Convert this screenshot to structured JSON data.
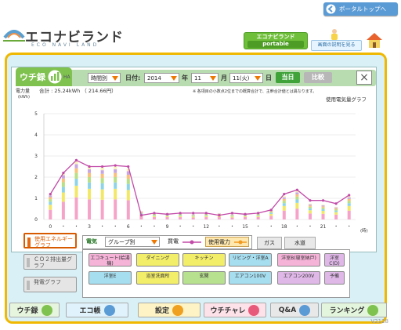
{
  "header": {
    "portal_button": "ポータルトップへ",
    "logo_jp": "エコナビランド",
    "logo_en": "ECO NAVI LAND",
    "portable_line1": "エコナビランド",
    "portable_line2": "portable",
    "explain_button": "画面の説明を見る"
  },
  "window": {
    "tab_title": "ウチ録",
    "tab_suffix": "HA",
    "mode_select": "時間別",
    "date_label": "日付:",
    "year_value": "2014",
    "year_unit": "年",
    "month_value": "11",
    "month_unit": "月",
    "day_value": "11(火)",
    "day_unit": "日",
    "today_button": "当日",
    "compare_button": "比較",
    "close_button": "×"
  },
  "chart_header": {
    "y_unit_line1": "電力量",
    "y_unit_line2": "(kWh)",
    "total": "合計 : 25.24kWh （ 214.66円）",
    "note": "※ 各項目の小数点2位までの概算合計で、主幹合計値とは異なります。",
    "chart_title": "使用電気量グラフ",
    "x_unit": "(時)"
  },
  "chart_data": {
    "type": "bar",
    "categories": [
      "0",
      "1",
      "2",
      "3",
      "4",
      "5",
      "6",
      "7",
      "8",
      "9",
      "10",
      "11",
      "12",
      "13",
      "14",
      "15",
      "16",
      "17",
      "18",
      "19",
      "20",
      "21",
      "22",
      "23"
    ],
    "x_tick_labels": [
      "0",
      "・",
      "・",
      "3",
      "・",
      "・",
      "6",
      "・",
      "・",
      "9",
      "・",
      "・",
      "12",
      "・",
      "・",
      "15",
      "・",
      "・",
      "18",
      "・",
      "・",
      "21",
      "・",
      "・"
    ],
    "values": [
      1.2,
      2.2,
      2.75,
      2.5,
      2.45,
      2.5,
      2.4,
      0.4,
      0.3,
      0.3,
      0.3,
      0.25,
      0.3,
      0.3,
      0.25,
      0.3,
      0.3,
      0.45,
      1.1,
      1.35,
      0.75,
      0.7,
      0.6,
      1.1
    ],
    "line_values": [
      1.2,
      2.2,
      2.8,
      2.5,
      2.5,
      2.55,
      2.5,
      0.2,
      0.3,
      0.25,
      0.3,
      0.3,
      0.3,
      0.2,
      0.3,
      0.25,
      0.3,
      0.45,
      1.2,
      1.4,
      0.9,
      0.9,
      0.75,
      1.15
    ],
    "y_ticks": [
      0,
      1,
      2,
      3,
      4,
      5
    ],
    "ylim": [
      0,
      5
    ],
    "grid": true,
    "segment_colors": [
      "#f5a3c8",
      "#f2e866",
      "#8ed4e8",
      "#b8e086",
      "#f9c17a",
      "#c7a7e0",
      "#f7f2b8"
    ],
    "line_color": "#c24aa8"
  },
  "side_buttons": [
    {
      "label": "使用エネルギーグラフ"
    },
    {
      "label": "ＣＯ２排出量グラフ"
    },
    {
      "label": "発電グラフ"
    }
  ],
  "filter": {
    "electric_label": "電気",
    "group_select": "グループ別",
    "buy_label": "買電",
    "usage_label": "使用電力",
    "gas_tab": "ガス",
    "water_tab": "水道"
  },
  "rooms": [
    {
      "label": "エコキュート(給湯機)",
      "color": "#f5b3d8"
    },
    {
      "label": "ダイニング",
      "color": "#f3ee6a"
    },
    {
      "label": "キッチン",
      "color": "#f3ee6a"
    },
    {
      "label": "リビング・洋室A",
      "color": "#a6ddef"
    },
    {
      "label": "洋室B(寝室納戸)",
      "color": "#f5b3d8"
    },
    {
      "label": "洋室C(D)",
      "color": "#e0b8e8"
    },
    {
      "label": "洋室E",
      "color": "#a6ddef"
    },
    {
      "label": "浴室洗面所",
      "color": "#f3ee6a"
    },
    {
      "label": "玄関",
      "color": "#b7e08f"
    },
    {
      "label": "エアコン100V",
      "color": "#a6ddef"
    },
    {
      "label": "エアコン200V",
      "color": "#e0b8e8"
    },
    {
      "label": "予備",
      "color": "#e0b8e8"
    }
  ],
  "bottom_nav": [
    {
      "label": "ウチ録",
      "color": "#e6f5de"
    },
    {
      "label": "エコ帳",
      "color": "#e0f2fb"
    },
    {
      "label": "設定",
      "color": "#fdf3c4"
    },
    {
      "label": "ウチチャレ",
      "color": "#fde2ea"
    },
    {
      "label": "Q&A",
      "color": "#e8e8e8"
    },
    {
      "label": "ランキング",
      "color": "#e3f5dc"
    }
  ],
  "version": "V2128"
}
